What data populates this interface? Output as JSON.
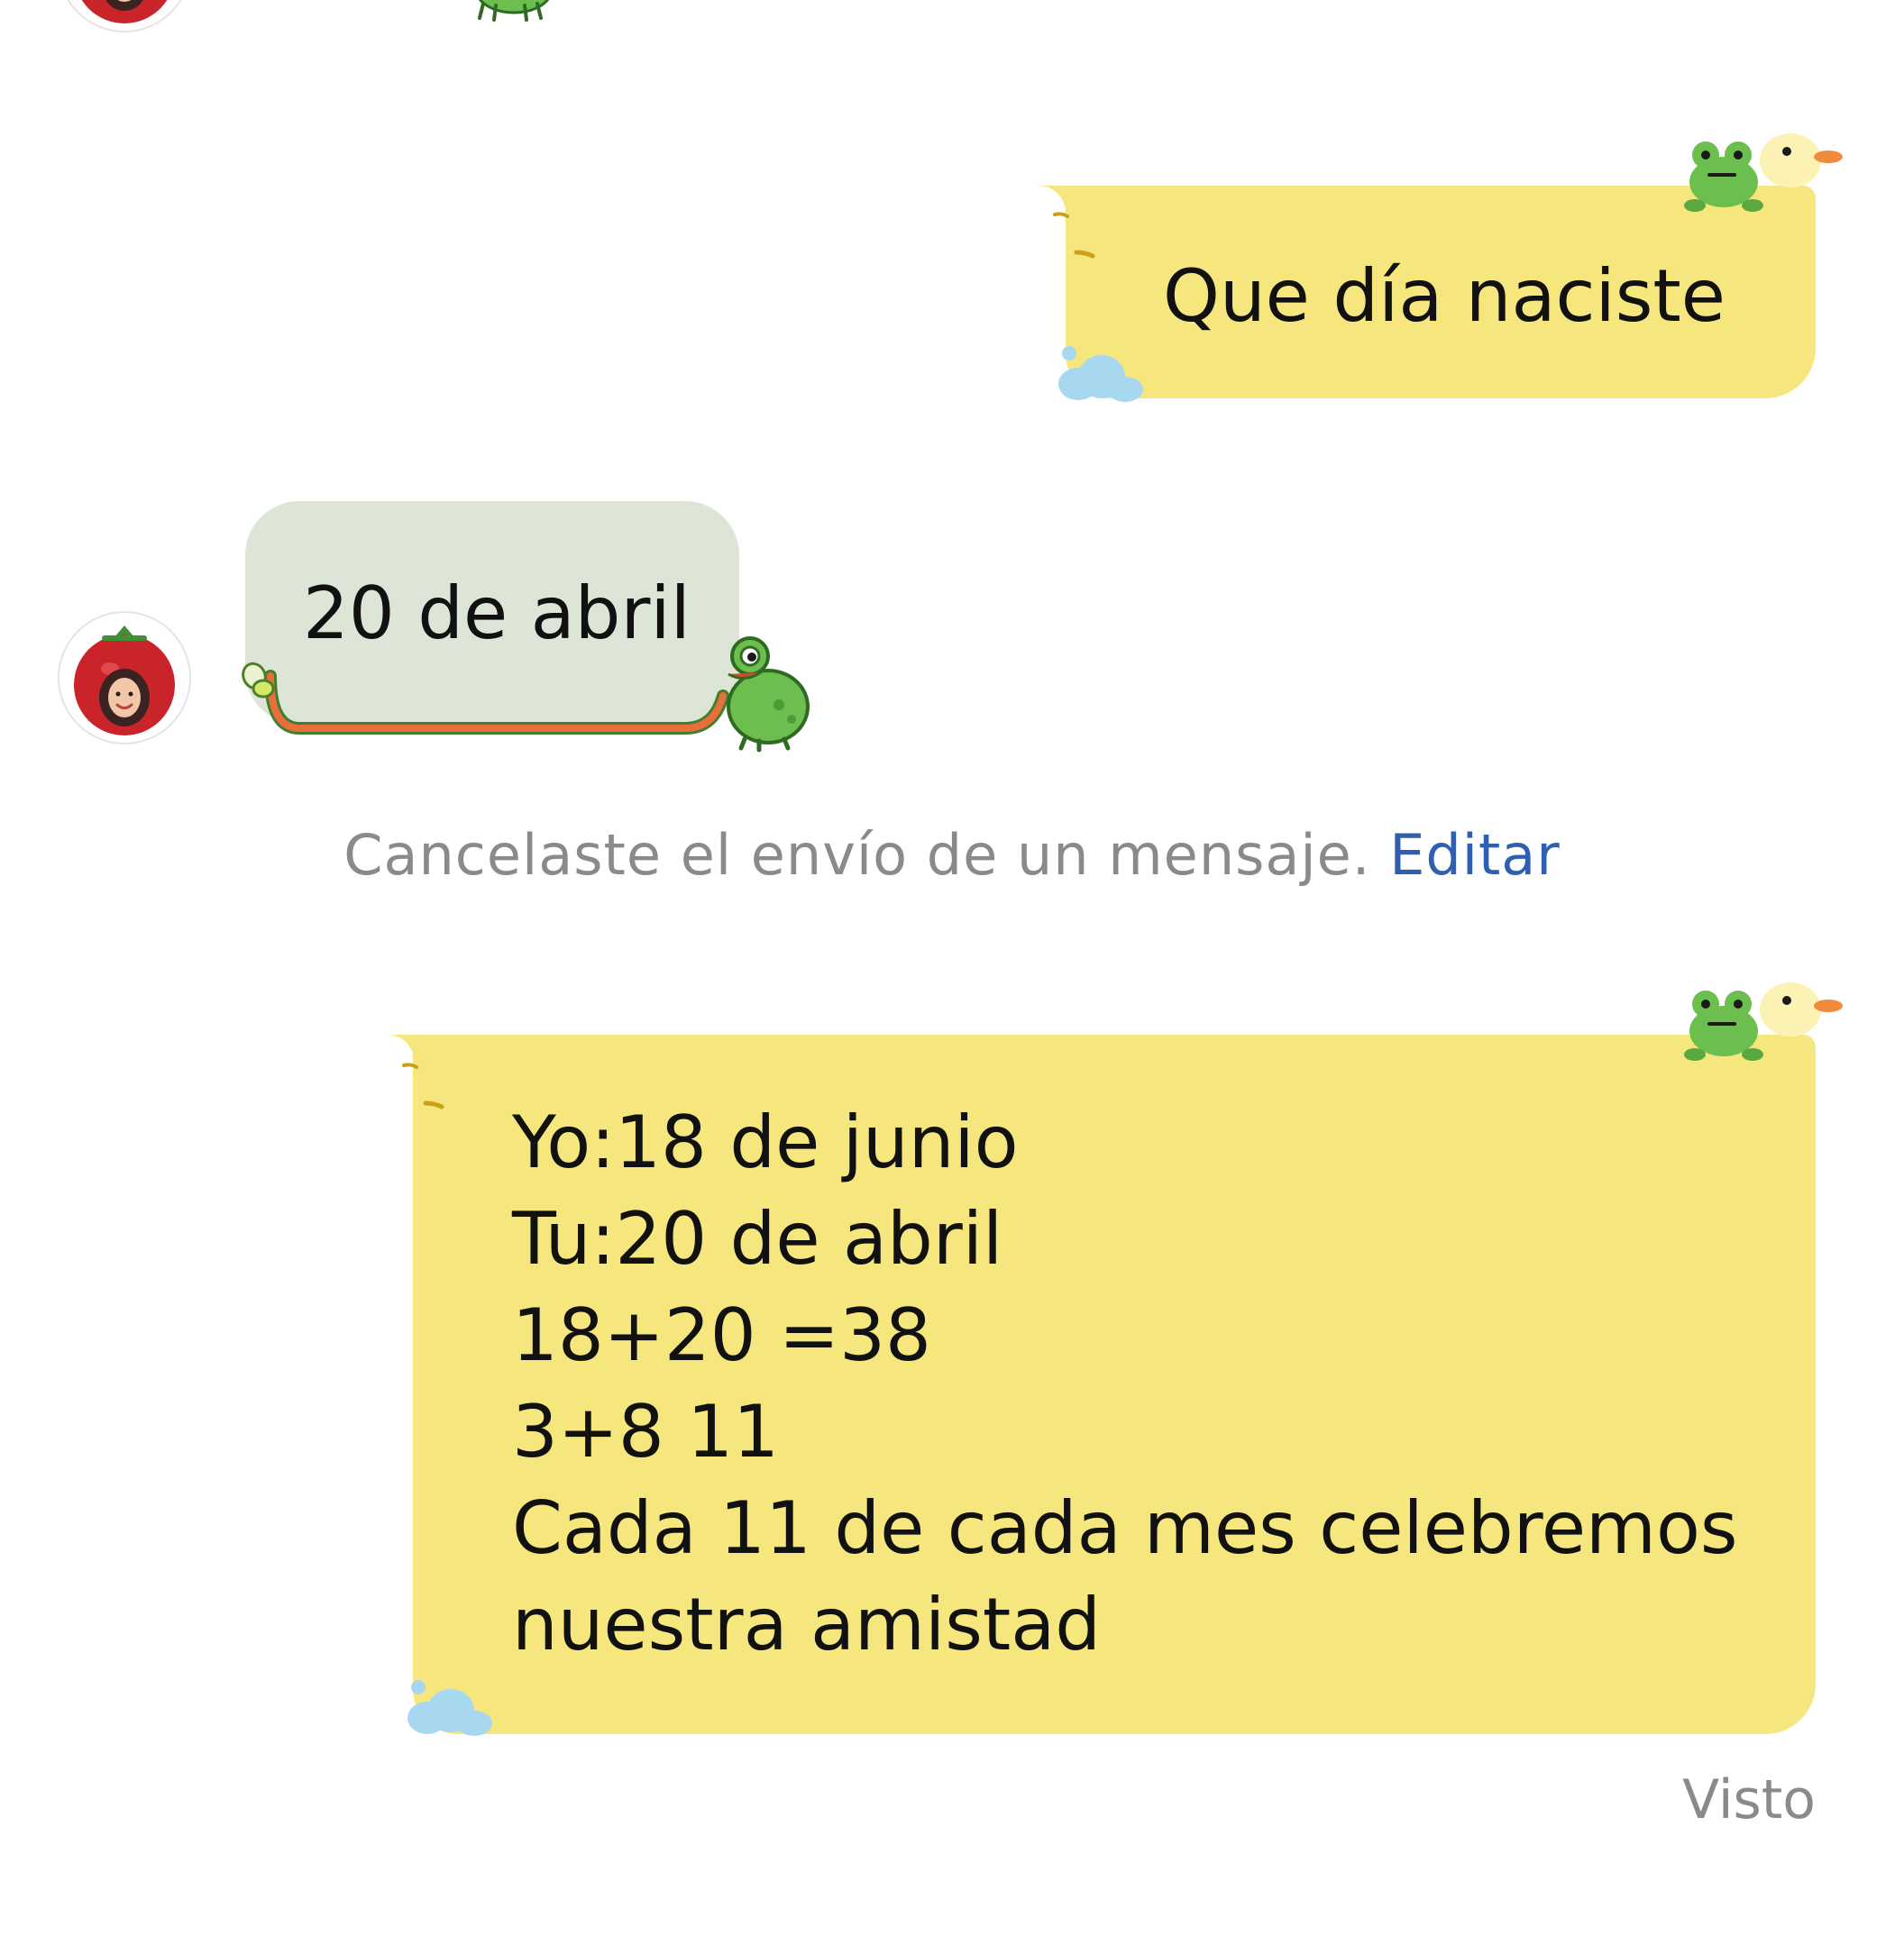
{
  "chat": {
    "messages": [
      {
        "direction": "outgoing",
        "text": "Que día naciste"
      },
      {
        "direction": "incoming",
        "text": "20 de abril"
      },
      {
        "direction": "outgoing",
        "lines": [
          "Yo:18 de junio",
          "Tu:20 de abril",
          "18+20 =38",
          "3+8 11",
          "Cada 11 de  cada mes celebremos",
          "nuestra amistad"
        ]
      }
    ],
    "notice": {
      "text": "Cancelaste el envío de un mensaje.",
      "edit_label": "Editar"
    },
    "seen_label": "Visto"
  },
  "colors": {
    "outgoing_bubble": "#f6e67e",
    "incoming_bubble": "#dce5d6",
    "link": "#2f5fb0",
    "muted_text": "#8a8a8a",
    "tongue": "#e86e3c",
    "frog": "#6cbf4e",
    "cloud": "#a8d7f0"
  },
  "icons": [
    "frog-sticker-icon",
    "duck-sticker-icon",
    "cloud-sticker-icon",
    "fly-sticker-icon",
    "contact-avatar"
  ]
}
